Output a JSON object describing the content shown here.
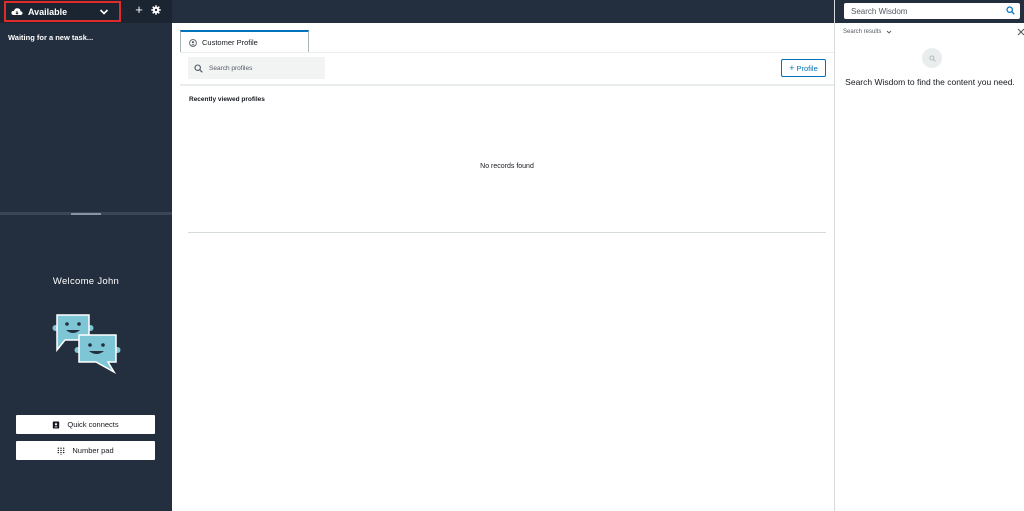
{
  "ccp": {
    "status": "Available",
    "waiting_text": "Waiting for a new task...",
    "welcome_text": "Welcome John",
    "quick_connects_label": "Quick connects",
    "number_pad_label": "Number pad",
    "add_label": "+"
  },
  "main": {
    "tab_label": "Customer Profile",
    "search_placeholder": "Search profiles",
    "profile_button_label": "Profile",
    "recent_heading": "Recently viewed profiles",
    "empty_message": "No records found"
  },
  "wisdom": {
    "search_placeholder": "Search Wisdom",
    "results_label": "Search results",
    "empty_message": "Search Wisdom to find the content you need."
  },
  "colors": {
    "ccp_bg": "#232f3e",
    "accent": "#0073bb",
    "highlight_border": "#e02b2b",
    "mascot": "#7ec6d6"
  }
}
